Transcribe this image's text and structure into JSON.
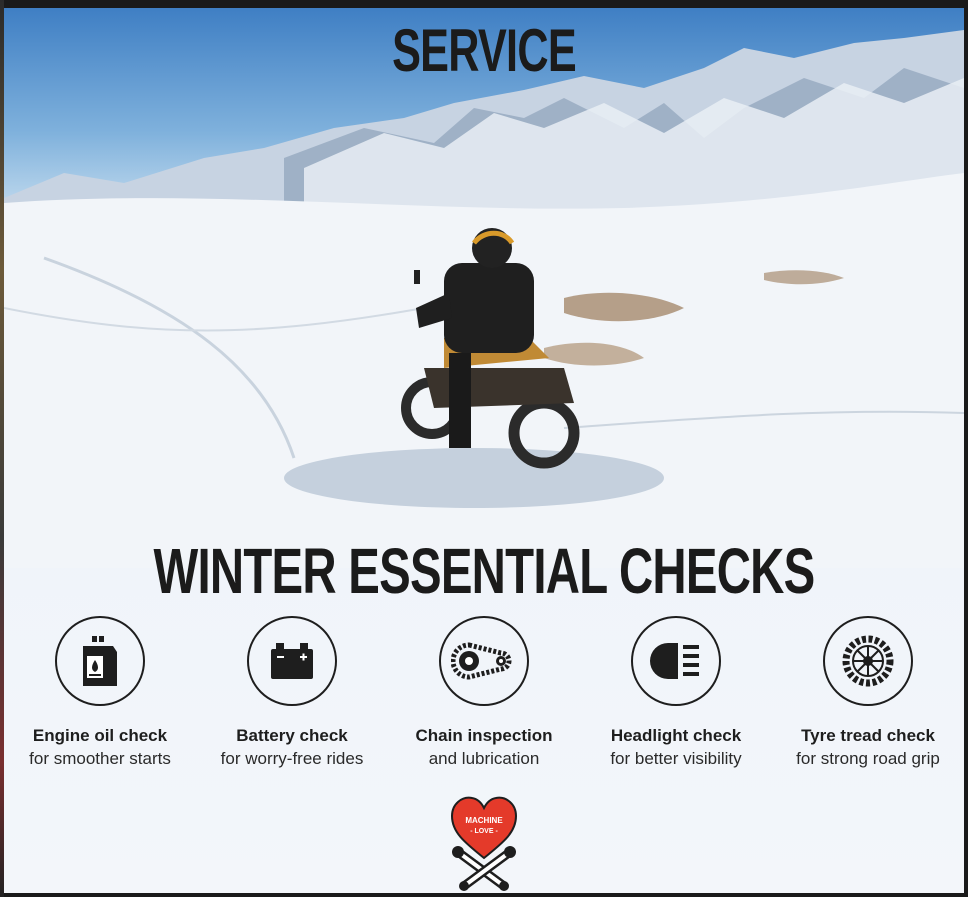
{
  "poster": {
    "top_title": "SERVICE",
    "main_title": "WINTER ESSENTIAL CHECKS"
  },
  "checks": [
    {
      "icon": "engine-oil-icon",
      "name": "Engine oil check",
      "desc": "for smoother starts"
    },
    {
      "icon": "battery-icon",
      "name": "Battery check",
      "desc": "for worry-free rides"
    },
    {
      "icon": "chain-icon",
      "name": "Chain inspection",
      "desc": "and lubrication"
    },
    {
      "icon": "headlight-icon",
      "name": "Headlight check",
      "desc": "for better visibility"
    },
    {
      "icon": "tyre-icon",
      "name": "Tyre tread check",
      "desc": "for strong road grip"
    }
  ],
  "logo": {
    "text_line1": "MACHINE",
    "text_line2": "- LOVE -",
    "color": "#e43a2a"
  },
  "colors": {
    "ink": "#1e1e1e",
    "sky": "#3f7fc4",
    "snow": "#f3f6fa"
  }
}
